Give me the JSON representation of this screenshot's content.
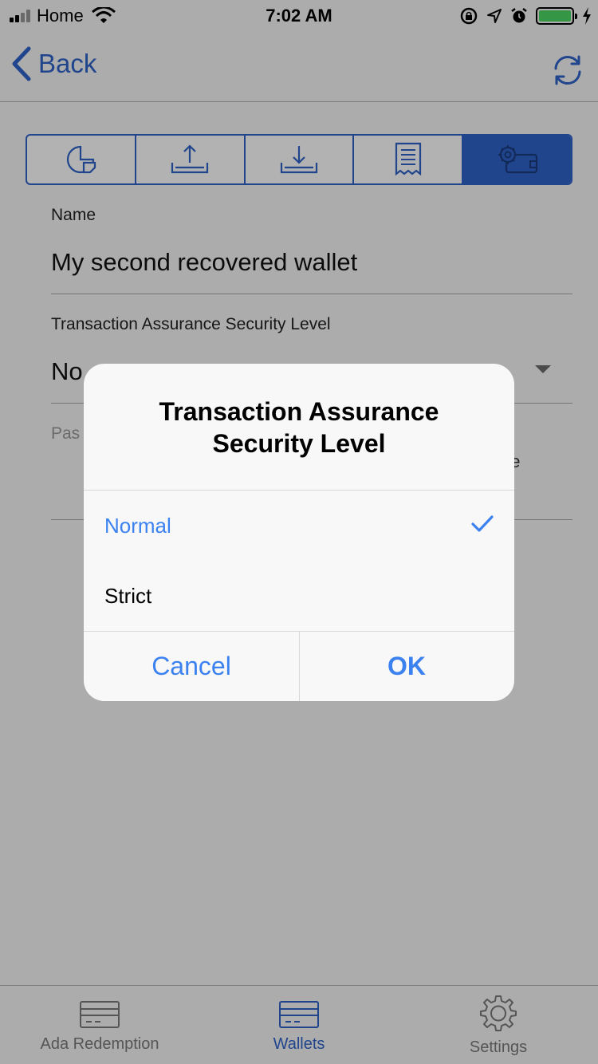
{
  "status_bar": {
    "carrier": "Home",
    "time": "7:02 AM"
  },
  "nav": {
    "back_label": "Back"
  },
  "segments": [
    "summary-icon",
    "send-icon",
    "receive-icon",
    "transactions-icon",
    "wallet-settings-icon"
  ],
  "form": {
    "name_label": "Name",
    "name_value": "My second recovered wallet",
    "assurance_label": "Transaction Assurance Security Level",
    "assurance_value_visible": "No",
    "password_label_visible": "Pas",
    "change_visible": "ge"
  },
  "dialog": {
    "title": "Transaction Assurance Security Level",
    "options": [
      {
        "label": "Normal",
        "selected": true
      },
      {
        "label": "Strict",
        "selected": false
      }
    ],
    "cancel_label": "Cancel",
    "ok_label": "OK"
  },
  "tabbar": {
    "tabs": [
      {
        "label": "Ada Redemption",
        "icon": "card-icon",
        "active": false
      },
      {
        "label": "Wallets",
        "icon": "wallet-card-icon",
        "active": true
      },
      {
        "label": "Settings",
        "icon": "gear-icon",
        "active": false
      }
    ]
  },
  "colors": {
    "accent": "#2e63c9",
    "dialog_accent": "#3b82f0",
    "battery": "#4cd964"
  }
}
